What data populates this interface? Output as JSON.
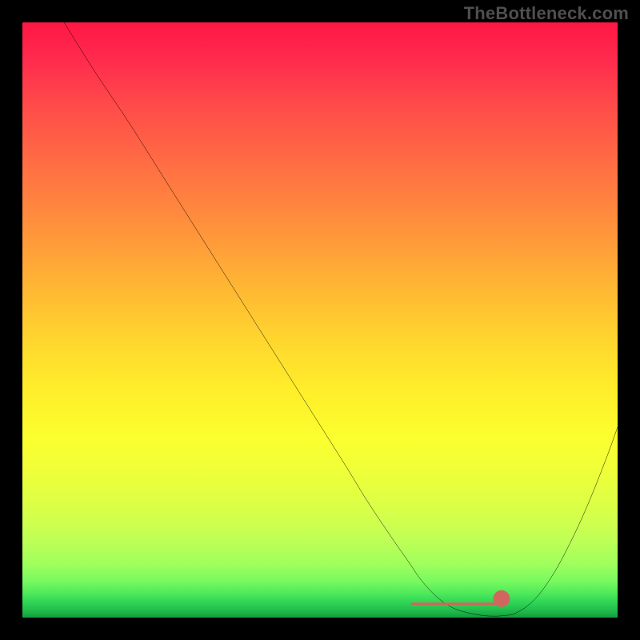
{
  "watermark": "TheBottleneck.com",
  "chart_data": {
    "type": "line",
    "title": "",
    "xlabel": "",
    "ylabel": "",
    "xlim": [
      0,
      100
    ],
    "ylim": [
      0,
      100
    ],
    "grid": false,
    "legend": false,
    "series": [
      {
        "name": "bottleneck-curve",
        "color": "#000000",
        "x": [
          7,
          12,
          18,
          24,
          30,
          36,
          42,
          48,
          54,
          58,
          62,
          65,
          67,
          69.5,
          72,
          74.5,
          77,
          79,
          81,
          83,
          86,
          89,
          92,
          95,
          98,
          100
        ],
        "y": [
          100,
          92,
          83,
          73.5,
          64,
          54.5,
          45,
          35.5,
          26,
          19.5,
          13.5,
          9.2,
          6.3,
          3.6,
          1.8,
          0.9,
          0.4,
          0.25,
          0.35,
          0.8,
          3.0,
          7.0,
          12.5,
          19.0,
          26.5,
          32.0
        ]
      }
    ],
    "annotations": [
      {
        "name": "flat-region-marker",
        "color": "#d1665f",
        "kind": "thick-segment",
        "x_start": 65.5,
        "x_end": 80.5,
        "y": 2.3
      },
      {
        "name": "end-dot",
        "color": "#d1665f",
        "kind": "dot",
        "x": 80.5,
        "y": 3.2,
        "r": 1.4
      }
    ]
  }
}
